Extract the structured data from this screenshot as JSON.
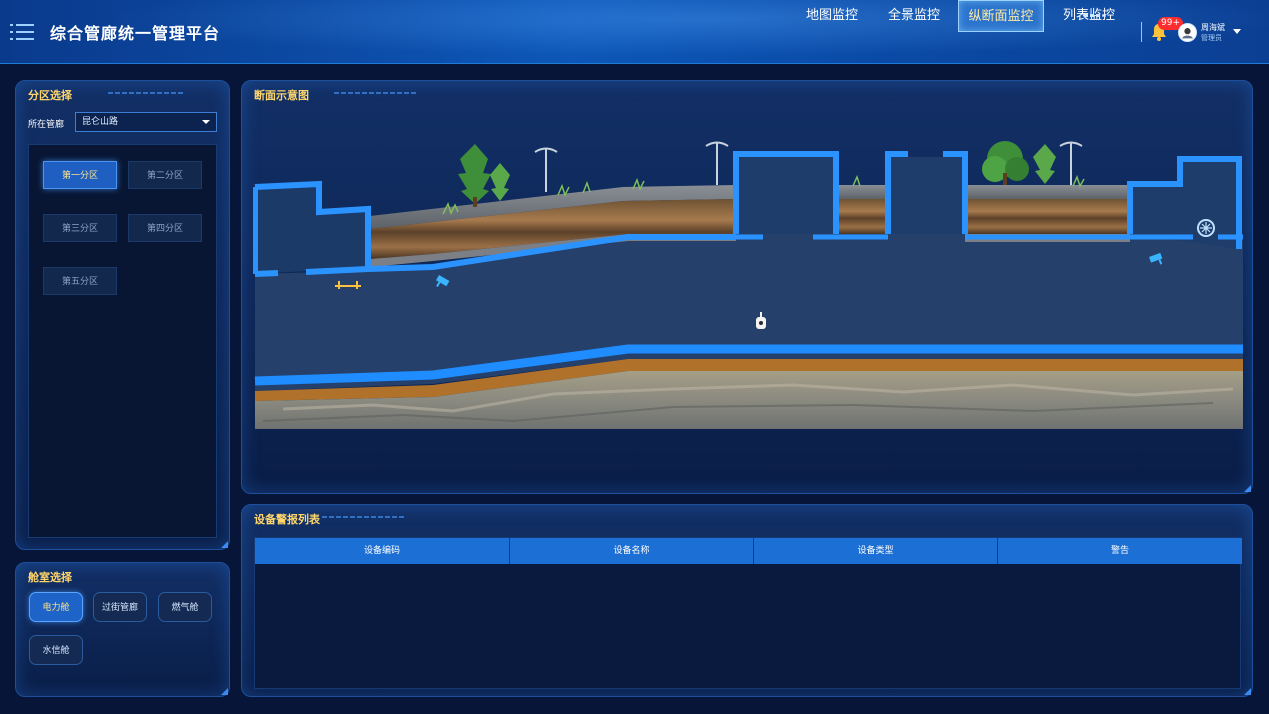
{
  "header": {
    "app_title": "综合管廊统一管理平台",
    "nav": [
      "地图监控",
      "全景监控",
      "纵断面监控",
      "列表监控"
    ],
    "active_nav": "纵断面监控",
    "notification_badge": "99+",
    "user_name": "周海斌",
    "user_role": "管理员"
  },
  "zone_panel": {
    "title": "分区选择",
    "field_label": "所在管廊",
    "selected_corridor": "昆仑山路",
    "zones": [
      "第一分区",
      "第二分区",
      "第三分区",
      "第四分区",
      "第五分区"
    ],
    "active_zone": "第一分区"
  },
  "cabin_panel": {
    "title": "舱室选择",
    "cabins": [
      "电力舱",
      "过街管廊",
      "燃气舱",
      "水信舱"
    ],
    "active_cabin": "电力舱"
  },
  "diagram_panel": {
    "title": "断面示意图"
  },
  "alarm_panel": {
    "title": "设备警报列表",
    "columns": [
      "设备编码",
      "设备名称",
      "设备类型",
      "警告"
    ],
    "rows": []
  },
  "colors": {
    "accent": "#1c6fd4",
    "title_gold": "#ffd66b",
    "wall_blue": "#1f8cff",
    "badge_red": "#ff2d2d"
  },
  "icons": [
    "menu-icon",
    "bell-icon",
    "user-avatar-icon",
    "chevron-down-icon",
    "camera-icon",
    "fan-icon",
    "sensor-icon"
  ]
}
